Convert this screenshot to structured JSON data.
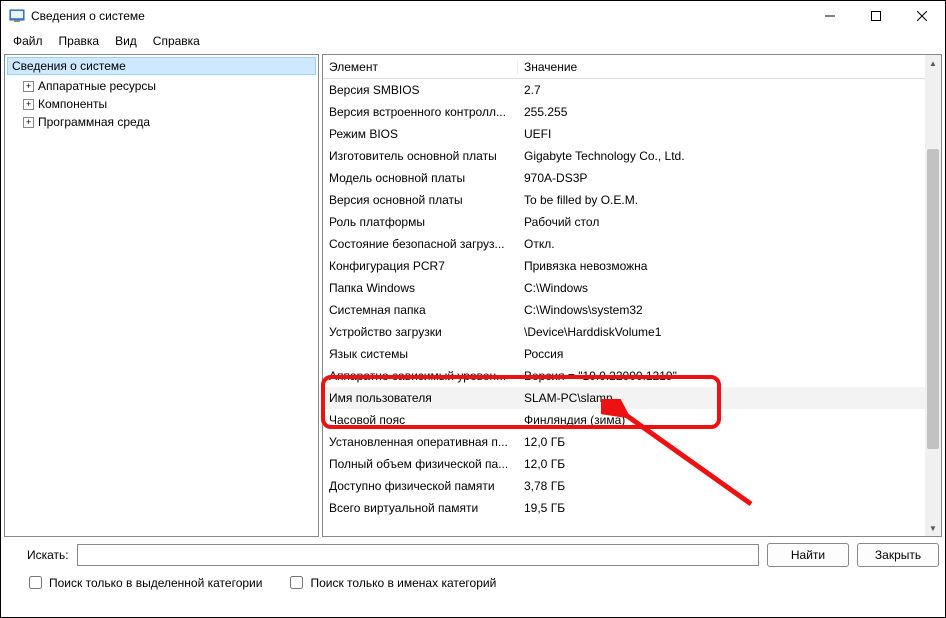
{
  "window": {
    "title": "Сведения о системе"
  },
  "menu": {
    "file": "Файл",
    "edit": "Правка",
    "view": "Вид",
    "help": "Справка"
  },
  "tree": {
    "root": "Сведения о системе",
    "items": [
      "Аппаратные ресурсы",
      "Компоненты",
      "Программная среда"
    ]
  },
  "table": {
    "headers": {
      "elem": "Элемент",
      "val": "Значение"
    },
    "rows": [
      {
        "elem": "Версия SMBIOS",
        "val": "2.7"
      },
      {
        "elem": "Версия встроенного контролл...",
        "val": "255.255"
      },
      {
        "elem": "Режим BIOS",
        "val": "UEFI"
      },
      {
        "elem": "Изготовитель основной платы",
        "val": "Gigabyte Technology Co., Ltd."
      },
      {
        "elem": "Модель основной платы",
        "val": "970A-DS3P"
      },
      {
        "elem": "Версия основной платы",
        "val": "To be filled by O.E.M."
      },
      {
        "elem": "Роль платформы",
        "val": "Рабочий стол"
      },
      {
        "elem": "Состояние безопасной загруз...",
        "val": "Откл."
      },
      {
        "elem": "Конфигурация PCR7",
        "val": "Привязка невозможна"
      },
      {
        "elem": "Папка Windows",
        "val": "C:\\Windows"
      },
      {
        "elem": "Системная папка",
        "val": "C:\\Windows\\system32"
      },
      {
        "elem": "Устройство загрузки",
        "val": "\\Device\\HarddiskVolume1"
      },
      {
        "elem": "Язык системы",
        "val": "Россия"
      },
      {
        "elem": "Аппаратно-зависимый уровен...",
        "val": "Версия = \"10.0.22000.1219\""
      },
      {
        "elem": "Имя пользователя",
        "val": "SLAM-PC\\slamn",
        "highlight": true
      },
      {
        "elem": "Часовой пояс",
        "val": "Финляндия (зима)"
      },
      {
        "elem": "Установленная оперативная п...",
        "val": "12,0 ГБ"
      },
      {
        "elem": "Полный объем физической па...",
        "val": "12,0 ГБ"
      },
      {
        "elem": "Доступно физической памяти",
        "val": "3,78 ГБ"
      },
      {
        "elem": "Всего виртуальной памяти",
        "val": "19,5 ГБ"
      }
    ]
  },
  "search": {
    "label": "Искать:",
    "find": "Найти",
    "close": "Закрыть",
    "chk1": "Поиск только в выделенной категории",
    "chk2": "Поиск только в именах категорий"
  }
}
